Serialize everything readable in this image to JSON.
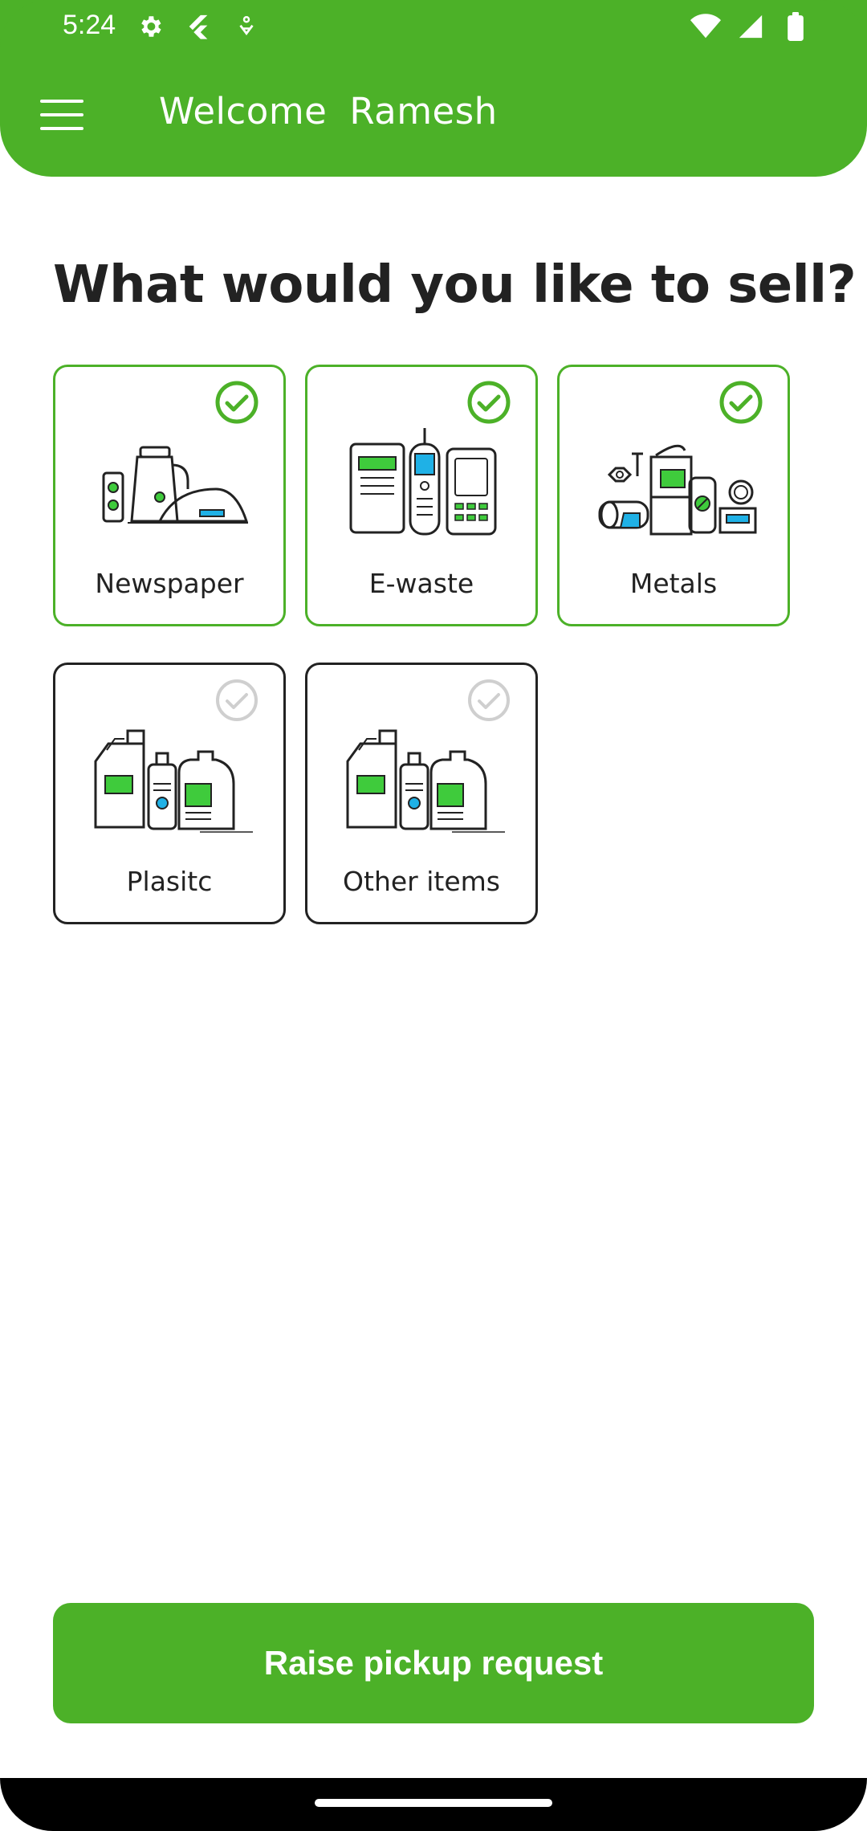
{
  "status_bar": {
    "time": "5:24",
    "left_icons": [
      "settings-icon",
      "flutter-icon",
      "accessibility-icon"
    ],
    "right_icons": [
      "wifi-icon",
      "signal-icon",
      "battery-icon"
    ]
  },
  "header": {
    "menu_icon": "hamburger-menu-icon",
    "welcome": "Welcome",
    "user_name": "Ramesh"
  },
  "main": {
    "question": "What would you like to sell?",
    "categories": [
      {
        "label": "Newspaper",
        "selected": true,
        "icon": "appliances-illustration"
      },
      {
        "label": "E-waste",
        "selected": true,
        "icon": "electronics-illustration"
      },
      {
        "label": "Metals",
        "selected": true,
        "icon": "metals-illustration"
      },
      {
        "label": "Plasitc",
        "selected": false,
        "icon": "plastic-bottles-illustration"
      },
      {
        "label": "Other items",
        "selected": false,
        "icon": "plastic-bottles-illustration"
      }
    ]
  },
  "cta": {
    "label": "Raise pickup request"
  },
  "colors": {
    "primary": "#4cb128",
    "text": "#222222",
    "accent_blue": "#1fb1e6",
    "accent_green": "#3fcb3c"
  }
}
